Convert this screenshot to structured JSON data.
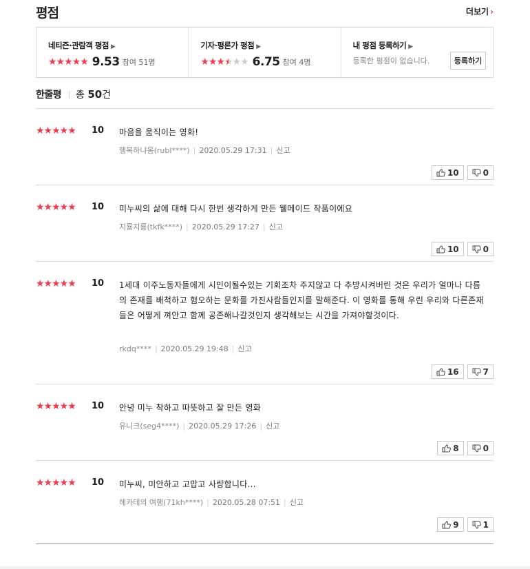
{
  "header": {
    "title": "평점",
    "more_label": "더보기",
    "more_chevron": "›"
  },
  "ratings": {
    "netizen": {
      "title": "네티즌·관람객 평점",
      "stars": "★★★★★",
      "score": "9.53",
      "participants": "참여 51명"
    },
    "critic": {
      "title": "기자·평론가 평점",
      "stars_full": "★★★",
      "stars_half": "★",
      "stars_off": "★★",
      "score": "6.75",
      "participants": "참여 4명"
    },
    "mine": {
      "title": "내 평점 등록하기",
      "message": "등록한 평점이 없습니다.",
      "button": "등록하기"
    }
  },
  "reviews_header": {
    "label": "한줄평",
    "total_prefix": "총 ",
    "total_count": "50",
    "total_suffix": "건"
  },
  "reviews": [
    {
      "stars": "★★★★★",
      "score": "10",
      "text": "마음을 움직이는 영화!",
      "user": "행복하냐옹(rubl****)",
      "date": "2020.05.29 17:31",
      "report": "신고",
      "likes": "10",
      "dislikes": "0"
    },
    {
      "stars": "★★★★★",
      "score": "10",
      "text": "미누씨의 삶에 대해 다시 한번 생각하게 만든 웰메이드 작품이에요",
      "user": "지룡지룡(tkfk****)",
      "date": "2020.05.29 17:27",
      "report": "신고",
      "likes": "10",
      "dislikes": "0"
    },
    {
      "stars": "★★★★★",
      "score": "10",
      "text": "1세대 이주노동자들에게 시민이될수있는 기회조차 주지않고 다 추방시켜버린 것은 우리가 얼마나 다름의 존재를 배척하고 혐오하는 문화를 가진사람들인지를 말해준다. 이 영화를 통해 우린 우리와 다른존재들은 어떻게 껴안고 함께 공존해나갈것인지 생각해보는 시간을 가져야할것이다.",
      "user": "rkdq****",
      "date": "2020.05.29 19:48",
      "report": "신고",
      "likes": "16",
      "dislikes": "7"
    },
    {
      "stars": "★★★★★",
      "score": "10",
      "text": "안녕 미누 착하고 따뜻하고 잘 만든 영화",
      "user": "유니크(seg4****)",
      "date": "2020.05.29 17:26",
      "report": "신고",
      "likes": "8",
      "dislikes": "0"
    },
    {
      "stars": "★★★★★",
      "score": "10",
      "text": "미누씨, 미안하고 고맙고 사랑합니다...",
      "user": "헤카테의 여행(71kh****)",
      "date": "2020.05.28 07:51",
      "report": "신고",
      "likes": "9",
      "dislikes": "1"
    }
  ],
  "colors": {
    "star": "#ef3c4d",
    "accent": "#e53a3a"
  },
  "icons": {
    "like": "thumbs-up-icon",
    "dislike": "thumbs-down-icon"
  }
}
